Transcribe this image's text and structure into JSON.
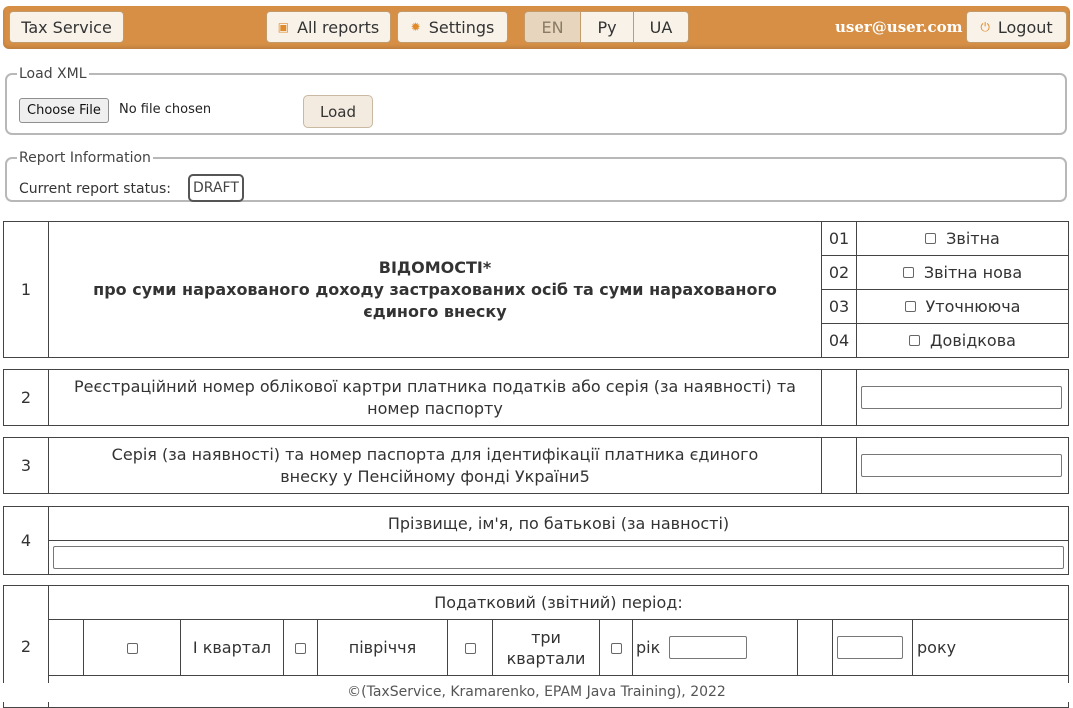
{
  "navbar": {
    "brand": "Tax Service",
    "all_reports": "All reports",
    "settings": "Settings",
    "languages": [
      "EN",
      "Ру",
      "UA"
    ],
    "active_language": "EN",
    "user_email": "user@user.com",
    "logout": "Logout",
    "icons": {
      "all_reports": "document-icon",
      "settings": "gear-icon",
      "logout": "power-icon"
    }
  },
  "load_xml": {
    "legend": "Load XML",
    "choose_file": "Choose File",
    "file_status": "No file chosen",
    "load_button": "Load"
  },
  "report_info": {
    "legend": "Report Information",
    "status_label": "Current report status:",
    "status_value": "DRAFT"
  },
  "form": {
    "row1": {
      "num": "1",
      "title_line1": "ВІДОМОСТІ*",
      "title_line2": "про суми нарахованого доходу застрахованих осіб та суми нарахованого єдиного внеску",
      "options": [
        {
          "code": "01",
          "label": "Звітна"
        },
        {
          "code": "02",
          "label": "Звітна нова"
        },
        {
          "code": "03",
          "label": "Уточнююча"
        },
        {
          "code": "04",
          "label": "Довідкова"
        }
      ]
    },
    "row2": {
      "num": "2",
      "label": "Реєстраційний номер облікової картри платника податків або серія (за наявності) та номер паспорту",
      "value": ""
    },
    "row3": {
      "num": "3",
      "label": "Серія (за наявності) та номер паспорта для ідентифікації платника єдиного внеску у Пенсійному фонді України5",
      "value": ""
    },
    "row4": {
      "num": "4",
      "label": "Прізвище, ім'я, по батькові (за навності)",
      "value": ""
    },
    "row5": {
      "num": "2",
      "label": "Податковий (звітний) період:",
      "q1": "І квартал",
      "half": "півріччя",
      "three_q": "три квартали",
      "year": "рік",
      "year_suffix": "року"
    }
  },
  "footer": "©(TaxService, Kramarenko, EPAM Java Training), 2022"
}
